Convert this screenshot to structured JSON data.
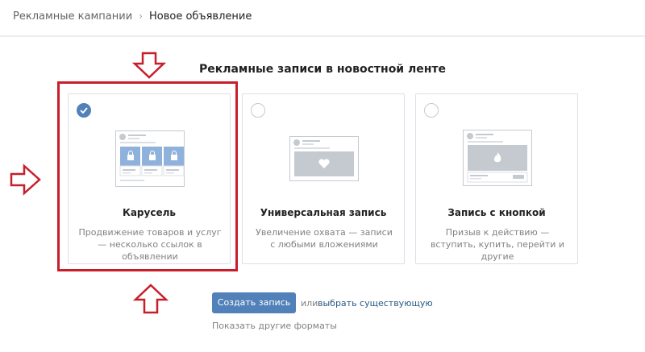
{
  "breadcrumb": {
    "parent": "Рекламные кампании",
    "separator": "›",
    "current": "Новое объявление"
  },
  "section_title": "Рекламные записи в новостной ленте",
  "formats": [
    {
      "title": "Карусель",
      "description": "Продвижение товаров и услуг — несколько ссылок в объявлении",
      "selected": true
    },
    {
      "title": "Универсальная запись",
      "description": "Увеличение охвата — записи с любыми вложениями",
      "selected": false
    },
    {
      "title": "Запись с кнопкой",
      "description": "Призыв к действию — вступить, купить, перейти и другие",
      "selected": false
    }
  ],
  "actions": {
    "create_label": "Создать запись",
    "or_text": "или",
    "choose_existing": "выбрать существующую",
    "other_formats": "Показать другие форматы"
  },
  "colors": {
    "accent": "#5181b8",
    "highlight": "#c81e2b"
  },
  "icons": [
    "checkmark-icon",
    "shopping-bag-icon",
    "heart-icon",
    "fire-icon",
    "arrow-down-icon",
    "arrow-right-icon",
    "arrow-up-icon"
  ]
}
